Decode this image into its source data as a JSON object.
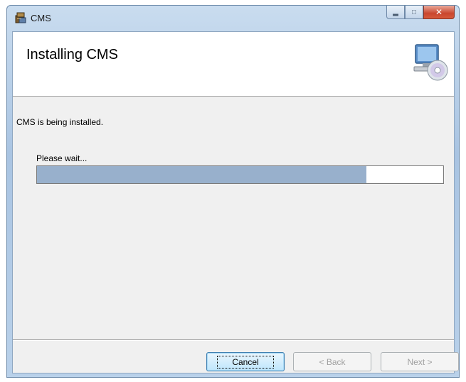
{
  "window": {
    "title": "CMS",
    "icons": {
      "app": "installer-package-icon",
      "minimize": "minimize-icon",
      "maximize": "maximize-icon",
      "close": "close-icon",
      "banner": "computer-with-disc-icon"
    }
  },
  "banner": {
    "title": "Installing CMS"
  },
  "body": {
    "status_text": "CMS is being installed.",
    "wait_text": "Please wait..."
  },
  "progress": {
    "percent": 81
  },
  "buttons": {
    "cancel": "Cancel",
    "back": "< Back",
    "next": "Next >"
  },
  "colors": {
    "progress_fill": "#98b0cc",
    "close_button": "#c9462e"
  }
}
